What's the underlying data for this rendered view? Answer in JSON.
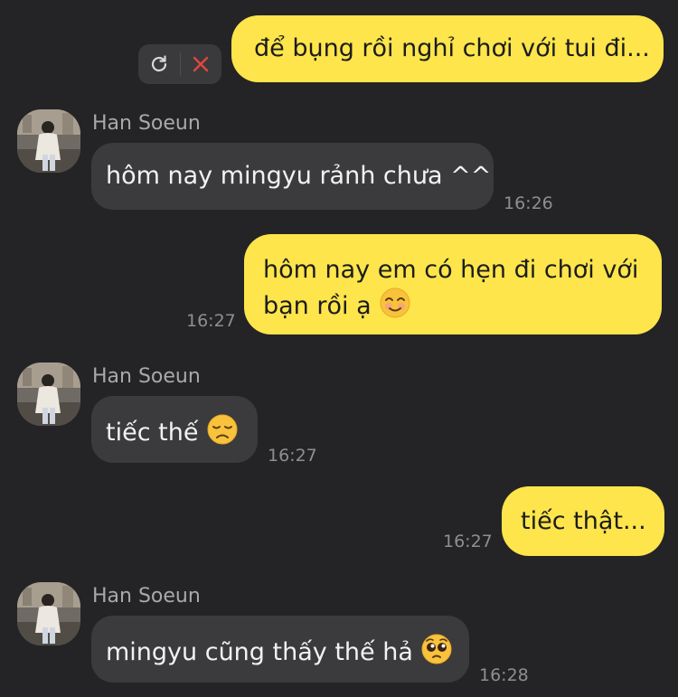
{
  "contact": {
    "name": "Han Soeun"
  },
  "failed_message": {
    "text": "để bụng rồi nghỉ chơi với tui đi...",
    "retry_icon": "retry-icon",
    "delete_icon": "delete-icon"
  },
  "messages": [
    {
      "direction": "in",
      "sender": "Han Soeun",
      "text": "hôm nay mingyu rảnh chưa ^^",
      "time": "16:26"
    },
    {
      "direction": "out",
      "line1": "hôm nay em có hẹn đi chơi với",
      "line2": "bạn rồi ạ",
      "emoji": "smiling-face-emoji",
      "time": "16:27"
    },
    {
      "direction": "in",
      "sender": "Han Soeun",
      "text": "tiếc thế",
      "emoji": "disappointed-face-emoji",
      "time": "16:27"
    },
    {
      "direction": "out",
      "text": "tiếc thật...",
      "time": "16:27"
    },
    {
      "direction": "in",
      "sender": "Han Soeun",
      "text": "mingyu cũng thấy thế hả",
      "emoji": "pleading-face-emoji",
      "time": "16:28"
    }
  ],
  "colors": {
    "background": "#242426",
    "outgoing_bubble": "#fde54b",
    "incoming_bubble": "#3b3b3d",
    "timestamp": "#8e8e93",
    "delete_icon": "#e0473e"
  }
}
